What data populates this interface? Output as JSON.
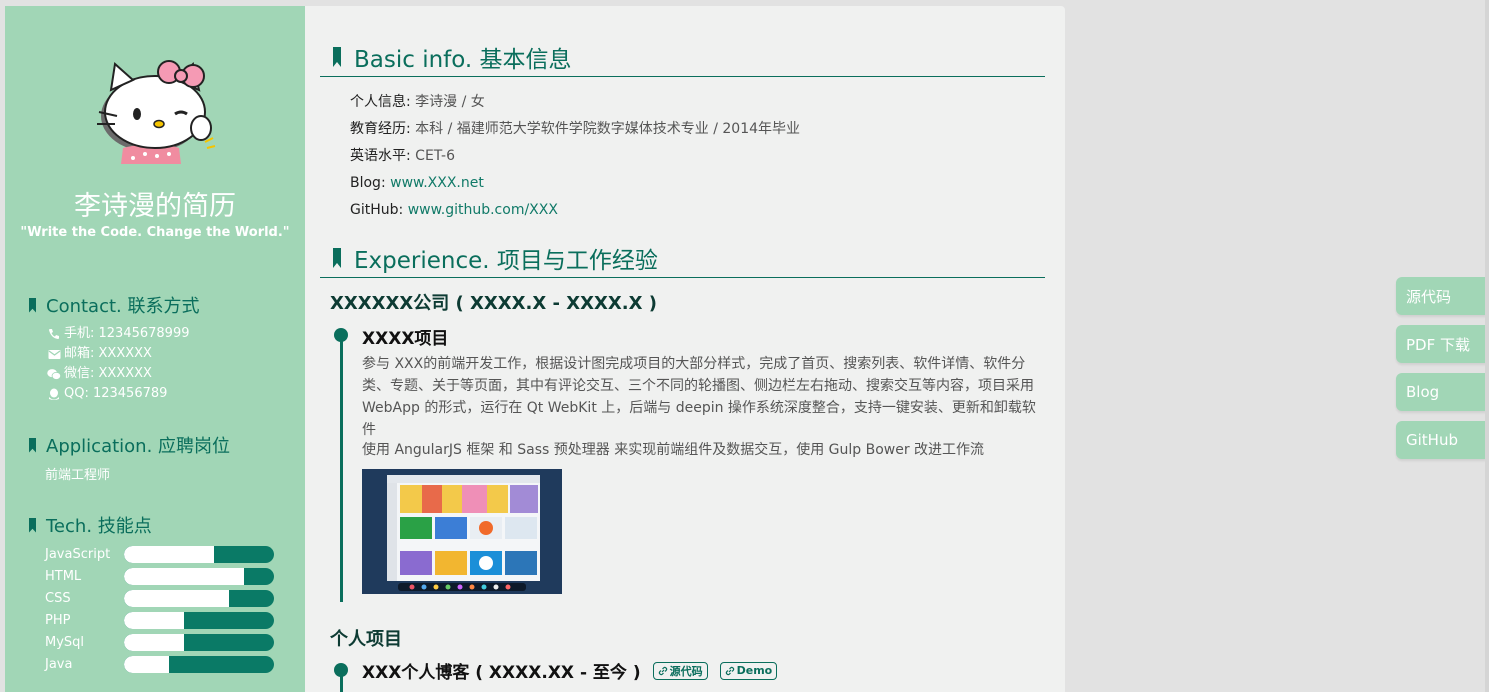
{
  "sidebar": {
    "name": "李诗漫的简历",
    "motto": "\"Write the Code. Change the World.\"",
    "contact": {
      "title": "Contact. 联系方式",
      "items": [
        {
          "icon": "phone-icon",
          "text": "手机: 12345678999"
        },
        {
          "icon": "mail-icon",
          "text": "邮箱: XXXXXX"
        },
        {
          "icon": "wechat-icon",
          "text": "微信: XXXXXX"
        },
        {
          "icon": "qq-icon",
          "text": "QQ: 123456789"
        }
      ]
    },
    "application": {
      "title": "Application. 应聘岗位",
      "text": "前端工程师"
    },
    "tech": {
      "title": "Tech. 技能点",
      "skills": [
        {
          "name": "JavaScript",
          "level": 0.6
        },
        {
          "name": "HTML",
          "level": 0.8
        },
        {
          "name": "CSS",
          "level": 0.7
        },
        {
          "name": "PHP",
          "level": 0.4
        },
        {
          "name": "MySql",
          "level": 0.4
        },
        {
          "name": "Java",
          "level": 0.3
        }
      ]
    }
  },
  "basic": {
    "title": "Basic info. 基本信息",
    "rows": [
      {
        "label": "个人信息:",
        "value": "李诗漫 / 女"
      },
      {
        "label": "教育经历:",
        "value": "本科 / 福建师范大学软件学院数字媒体技术专业 / 2014年毕业"
      },
      {
        "label": "英语水平:",
        "value": "CET-6"
      },
      {
        "label": "Blog:",
        "value": "www.XXX.net"
      },
      {
        "label": "GitHub:",
        "value": "www.github.com/XXX"
      }
    ]
  },
  "experience": {
    "title": "Experience. 项目与工作经验",
    "company": "XXXXXX公司 ( XXXX.X - XXXX.X )",
    "project": {
      "title": "XXXX项目",
      "desc1": "参与 XXX的前端开发工作，根据设计图完成项目的大部分样式，完成了首页、搜索列表、软件详情、软件分类、专题、关于等页面，其中有评论交互、三个不同的轮播图、侧边栏左右拖动、搜索交互等内容，项目采用 WebApp 的形式，运行在 Qt WebKit 上，后端与 deepin 操作系统深度整合，支持一键安装、更新和卸载软件",
      "desc2": "使用 AngularJS 框架 和 Sass 预处理器 来实现前端组件及数据交互，使用 Gulp Bower 改进工作流"
    },
    "personal": {
      "title": "个人项目",
      "project_title": "XXX个人博客 ( XXXX.XX - 至今 )",
      "tag_source": "源代码",
      "tag_demo": "Demo"
    }
  },
  "float_buttons": [
    "源代码",
    "PDF 下载",
    "Blog",
    "GitHub"
  ],
  "colors": {
    "accent": "#0a6e5c",
    "sidebar": "#a1d6b6",
    "main_bg": "#f0f1f0"
  }
}
